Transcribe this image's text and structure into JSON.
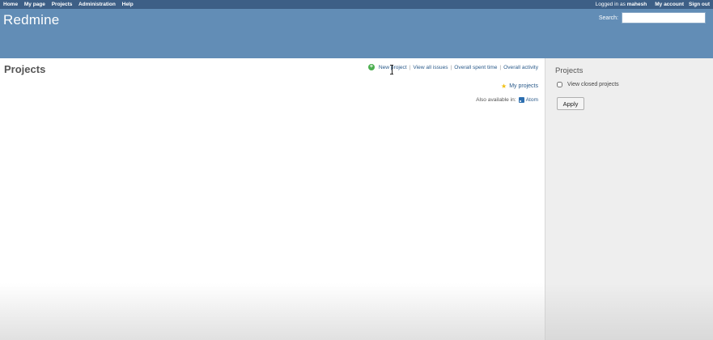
{
  "top_menu": {
    "items": [
      "Home",
      "My page",
      "Projects",
      "Administration",
      "Help"
    ],
    "logged_in_prefix": "Logged in as",
    "username": "mahesh",
    "my_account": "My account",
    "sign_out": "Sign out"
  },
  "header": {
    "title": "Redmine",
    "search_label": "Search:",
    "search_value": ""
  },
  "content": {
    "title": "Projects",
    "actions": [
      "New project",
      "View all issues",
      "Overall spent time",
      "Overall activity"
    ],
    "my_projects": "My projects",
    "also_available": "Also available in:",
    "atom": "Atom"
  },
  "sidebar": {
    "title": "Projects",
    "view_closed_label": "View closed projects",
    "apply_label": "Apply"
  },
  "icons": {
    "new_project": "plus-circle-icon",
    "my_projects": "star-icon",
    "atom": "feed-icon"
  },
  "colors": {
    "top_menu_bg": "#3d5f86",
    "header_bg": "#628db6",
    "link": "#2a5a8a",
    "sidebar_bg": "#eeeeee"
  }
}
